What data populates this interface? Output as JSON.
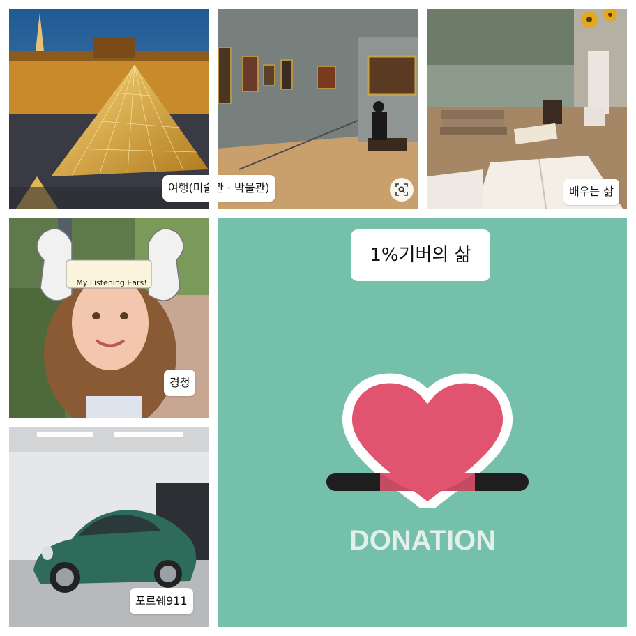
{
  "tiles": [
    {
      "id": "travel",
      "caption": "여행(미술관 · 박물관)"
    },
    {
      "id": "gallery",
      "caption": "여행(미술관 · 박물관)"
    },
    {
      "id": "learning",
      "caption": "배우는 삶"
    },
    {
      "id": "listening",
      "caption": "경청",
      "headband_text": "My Listening Ears!"
    },
    {
      "id": "car",
      "caption": "포르쉐911"
    }
  ],
  "donation_tile": {
    "headline": "1%기버의 삶",
    "word": "DONATION",
    "colors": {
      "background": "#74c0ab",
      "heart": "#e0546f",
      "bar": "#1e1e1e",
      "outline": "#ffffff"
    }
  },
  "icons": {
    "lens": "visual-search-icon"
  }
}
